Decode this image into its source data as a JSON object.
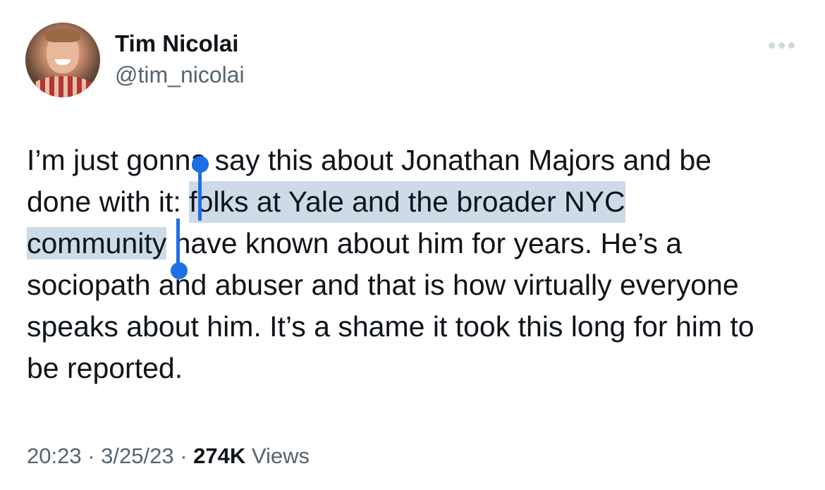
{
  "user": {
    "name": "Tim Nicolai",
    "handle": "@tim_nicolai"
  },
  "icons": {
    "avatar": "profile-photo",
    "more": "more-options-icon"
  },
  "tweet": {
    "lines": [
      {
        "before": "I’m just gonna say this about Jonathan Majors and be"
      },
      {
        "before": "done with it: ",
        "selected": "folks at Yale and the broader NYC"
      },
      {
        "selected": "community",
        "after": " have known about him for years. He’s a"
      },
      {
        "before": "sociopath and abuser and that is how virtually everyone"
      },
      {
        "before": "speaks about him. It’s a shame it took this long for him to"
      },
      {
        "before": "be reported."
      }
    ]
  },
  "meta": {
    "time": "20:23",
    "separator1": " · ",
    "date": "3/25/23",
    "separator2": " · ",
    "views_count": "274K",
    "views_label": " Views"
  },
  "colors": {
    "text": "#0f1419",
    "secondary": "#536471",
    "selection": "#cddbe9",
    "selection_handle": "#1d6fe6"
  }
}
